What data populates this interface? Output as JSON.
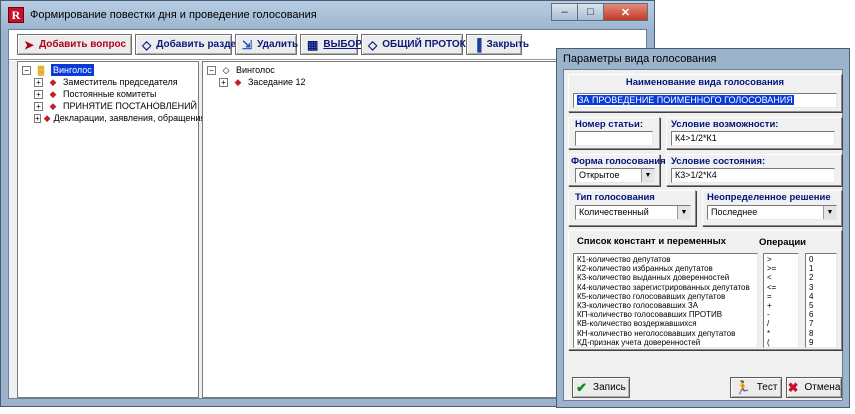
{
  "main_window": {
    "title": "Формирование повестки дня и проведение голосования",
    "app_icon": "R",
    "controls": {
      "minimize": "–",
      "maximize": "□",
      "close": "✕"
    },
    "toolbar": [
      {
        "label": "Добавить вопрос",
        "icon": "red-arrow-icon"
      },
      {
        "label": "Добавить раздел",
        "icon": "diamond-icon"
      },
      {
        "label": "Удалить",
        "icon": "delete-icon"
      },
      {
        "label": "ВЫБОР",
        "icon": "select-icon"
      },
      {
        "label": "ОБЩИЙ ПРОТОКОЛ",
        "icon": "diamond-icon"
      },
      {
        "label": "Закрыть",
        "icon": "close-door-icon"
      }
    ],
    "left_tree": {
      "root": "Винголос",
      "children": [
        "Заместитель председателя",
        "Постоянные комитеты",
        "ПРИНЯТИЕ ПОСТАНОВЛЕНИЙ",
        "Декларации, заявления, обращения"
      ]
    },
    "right_tree": {
      "root": "Винголос",
      "children": [
        "Заседание 12"
      ]
    }
  },
  "dialog": {
    "title": "Параметры вида голосования",
    "name_label": "Наименование вида голосования",
    "name_value": "ЗА ПРОВЕДЕНИЕ ПОИМЕННОГО ГОЛОСОВАНИЯ",
    "article_label": "Номер статьи:",
    "article_value": "",
    "possibility_label": "Условие возможности:",
    "possibility_value": "К4>1/2*К1",
    "form_label": "Форма голосования",
    "form_value": "Открытое",
    "state_label": "Условие состояния:",
    "state_value": "К3>1/2*К4",
    "type_label": "Тип голосования",
    "type_value": "Количественный",
    "undefined_label": "Неопределенное решение",
    "undefined_value": "Последнее",
    "constants_label": "Список констант и переменных",
    "constants": [
      "К1-количество депутатов",
      "К2-количество избранных депутатов",
      "К3-количество выданных доверенностей",
      "К4-количество зарегистрированных депутатов",
      "К5-количество голосовавших депутатов",
      "КЗ-количество голосовавших ЗА",
      "КП-количество голосовавших ПРОТИВ",
      "КВ-количество воздержавшихся",
      "КН-количество неголосовавших депутатов",
      "КД-признак учета доверенностей"
    ],
    "operations_label": "Операции",
    "operations": [
      ">",
      ">=",
      "<",
      "<=",
      "=",
      "+",
      "-",
      "/",
      "*",
      "("
    ],
    "digits": [
      "0",
      "1",
      "2",
      "3",
      "4",
      "5",
      "6",
      "7",
      "8",
      "9"
    ],
    "buttons": {
      "save": "Запись",
      "test": "Тест",
      "cancel": "Отмена"
    }
  }
}
